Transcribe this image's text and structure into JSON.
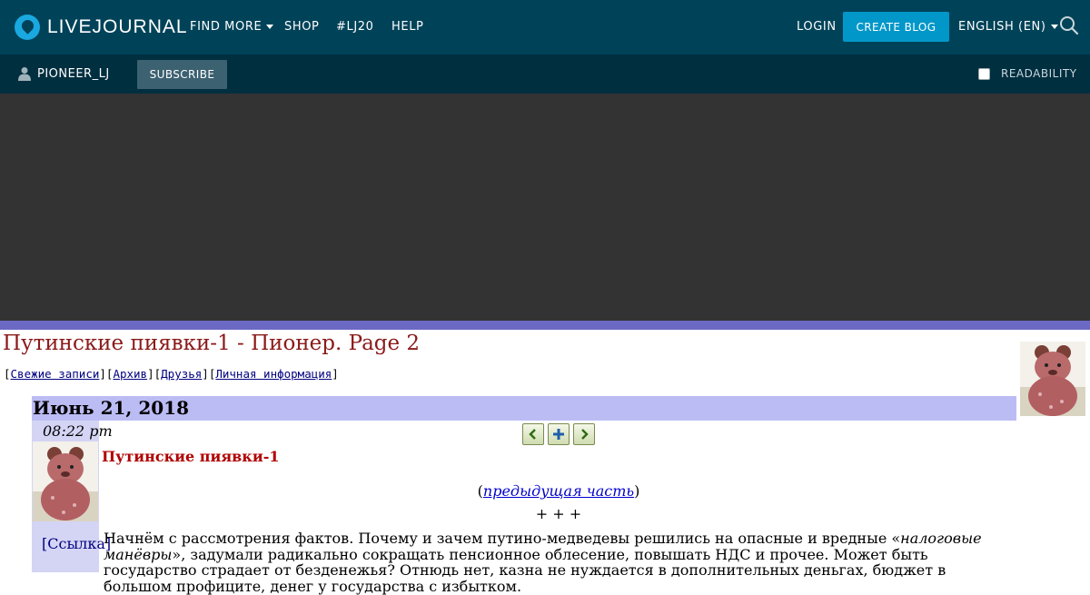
{
  "header": {
    "logo_text": "LIVEJOURNAL",
    "nav": {
      "find_more": "FIND MORE",
      "shop": "SHOP",
      "lj20": "#LJ20",
      "help": "HELP"
    },
    "login": "LOGIN",
    "create_blog": "CREATE BLOG",
    "language": "ENGLISH (EN)"
  },
  "subbar": {
    "username": "PIONEER_LJ",
    "subscribe": "SUBSCRIBE",
    "readability": "READABILITY",
    "readability_checked": false
  },
  "colors": {
    "topbar": "#004359",
    "subbar": "#002f40",
    "accent_button": "#0297c9",
    "ad_area": "#333333",
    "stripe": "#6b69c4",
    "date_bar": "#bcbcf5",
    "title": "#8b1a1a"
  },
  "journal": {
    "title": "Путинские пиявки-1 - Пионер. Page 2",
    "links": {
      "recent": "Свежие записи",
      "archive": "Архив",
      "friends": "Друзья",
      "info": "Личная информация"
    }
  },
  "entry": {
    "date": "Июнь 21, 2018",
    "time": "08:22 pm",
    "link_label": "[Ссылка]",
    "title": "Путинские пиявки-1",
    "previous_link": "предыдущая часть",
    "separator": "+ + +",
    "body_1": "Начнём с рассмотрения фактов. Почему и зачем путино-медведевы решились на опасные и вредные «",
    "body_italic": "налоговые манёвры",
    "body_2": "», задумали радикально сокращать пенсионное облесение, повышать НДС и прочее. Может быть государство страдает от безденежья? Отнюдь нет, казна не нуждается в дополнительных деньгах, бюджет в большом профиците, денег у государства с избытком."
  },
  "icons": {
    "logo": "livejournal-logo-icon",
    "search": "search-icon",
    "user": "user-icon",
    "prev_entry": "arrow-left-icon",
    "add_memory": "plus-icon",
    "next_entry": "arrow-right-icon",
    "userpic": "winnie-the-pooh-userpic"
  }
}
